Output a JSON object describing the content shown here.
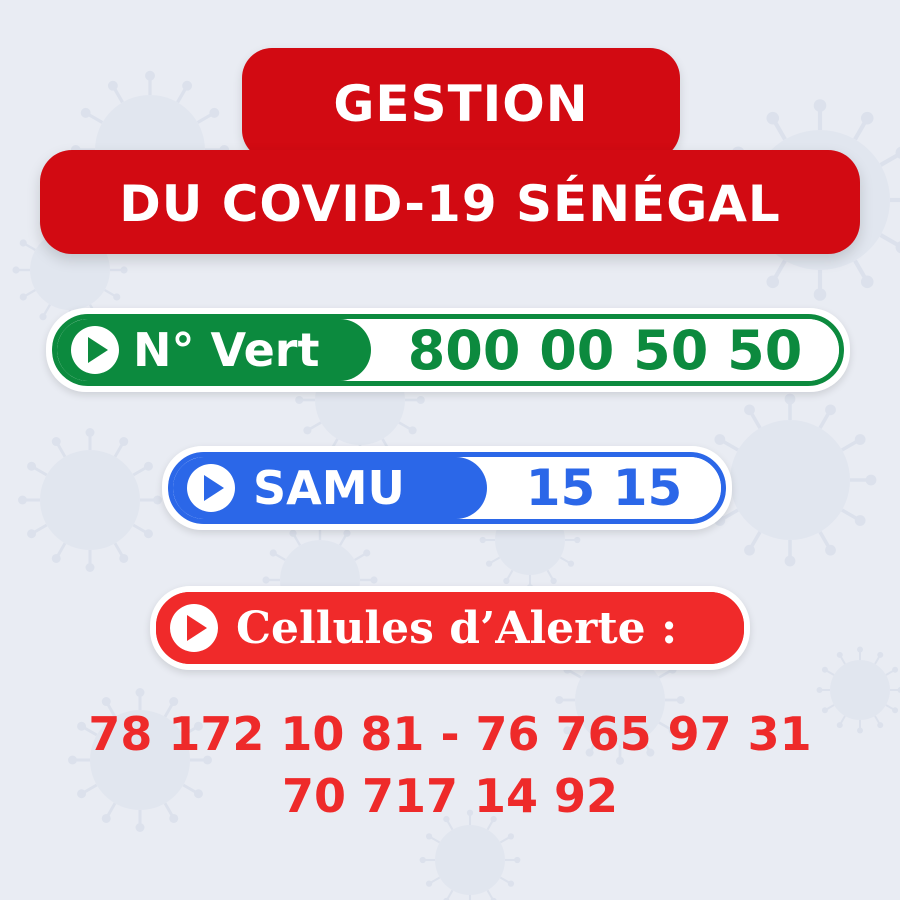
{
  "title": {
    "line1": "GESTION",
    "line2": "DU COVID-19 SÉNÉGAL"
  },
  "hotlines": [
    {
      "label": "N° Vert",
      "number": "800 00 50 50",
      "color": "#0c8a3e",
      "icon": "play-icon"
    },
    {
      "label": "SAMU",
      "number": "15 15",
      "color": "#2b67e8",
      "icon": "play-icon"
    }
  ],
  "alert": {
    "label": "Cellules d’Alerte :",
    "color": "#f02a2a",
    "icon": "play-icon",
    "numbers_line1": "78 172 10 81 - 76 765 97 31",
    "numbers_line2": "70 717 14 92"
  },
  "colors": {
    "banner_red": "#d20a12",
    "background": "#e9ecf3"
  },
  "background_motif": "virus-icon"
}
